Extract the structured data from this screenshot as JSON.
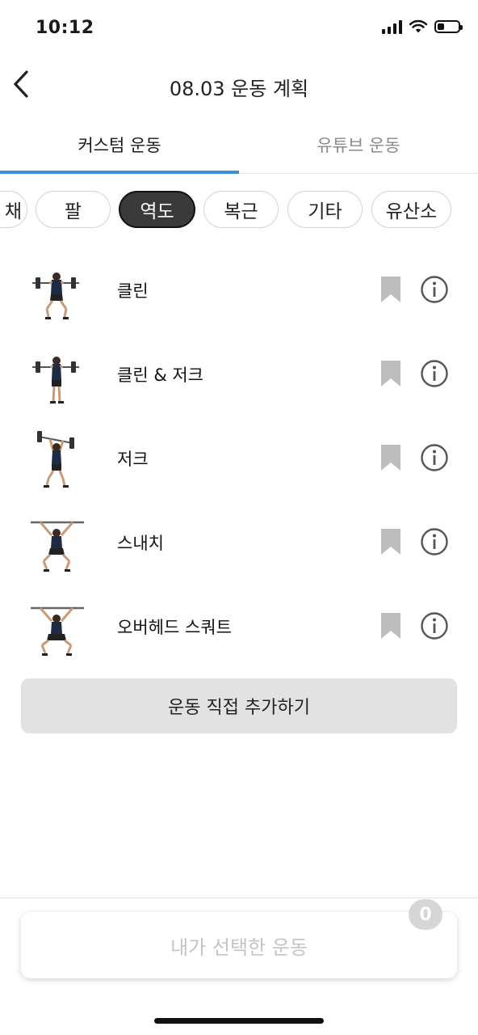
{
  "status_bar": {
    "time": "10:12",
    "battery_level": 0.35
  },
  "header": {
    "title": "08.03 운동 계획"
  },
  "tabs": [
    {
      "label": "커스텀 운동",
      "active": true
    },
    {
      "label": "유튜브 운동",
      "active": false
    }
  ],
  "categories": [
    {
      "label": "채",
      "selected": false
    },
    {
      "label": "팔",
      "selected": false
    },
    {
      "label": "역도",
      "selected": true
    },
    {
      "label": "복근",
      "selected": false
    },
    {
      "label": "기타",
      "selected": false
    },
    {
      "label": "유산소",
      "selected": false
    }
  ],
  "exercises": [
    {
      "name": "클린",
      "icons": [
        "athlete-thumbnail",
        "bookmark-icon",
        "info-icon"
      ]
    },
    {
      "name": "클린 & 저크",
      "icons": [
        "athlete-thumbnail",
        "bookmark-icon",
        "info-icon"
      ]
    },
    {
      "name": "저크",
      "icons": [
        "athlete-thumbnail",
        "bookmark-icon",
        "info-icon"
      ]
    },
    {
      "name": "스내치",
      "icons": [
        "athlete-thumbnail",
        "bookmark-icon",
        "info-icon"
      ]
    },
    {
      "name": "오버헤드 스쿼트",
      "icons": [
        "athlete-thumbnail",
        "bookmark-icon",
        "info-icon"
      ]
    }
  ],
  "add_button": {
    "label": "운동 직접 추가하기"
  },
  "selected_button": {
    "label": "내가 선택한 운동",
    "count": "0"
  },
  "colors": {
    "accent": "#3b8fe0",
    "chip_selected": "#3a3a3a",
    "bookmark": "#bdbdbd",
    "button_bg": "#e2e2e2"
  }
}
